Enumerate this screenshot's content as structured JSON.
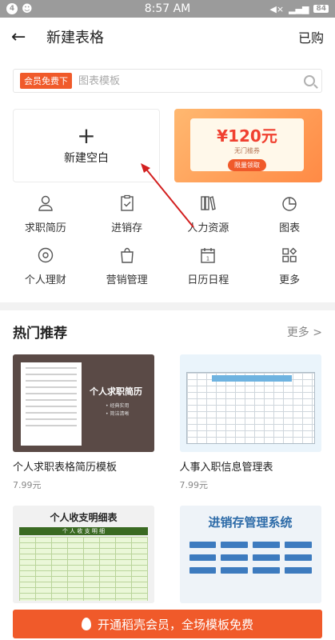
{
  "status": {
    "badge": "4",
    "time": "8:57 AM",
    "battery": "84"
  },
  "header": {
    "title": "新建表格",
    "action": "已购"
  },
  "search": {
    "vip_tag": "会员免费下",
    "placeholder": "图表模板"
  },
  "blank": {
    "label": "新建空白"
  },
  "promo": {
    "amount": "¥120元",
    "subtitle": "无门槛券",
    "button": "限量领取"
  },
  "categories": [
    {
      "label": "求职简历",
      "icon": "user-icon"
    },
    {
      "label": "进销存",
      "icon": "clipboard-icon"
    },
    {
      "label": "人力资源",
      "icon": "books-icon"
    },
    {
      "label": "图表",
      "icon": "pie-chart-icon"
    },
    {
      "label": "个人理财",
      "icon": "coin-icon"
    },
    {
      "label": "营销管理",
      "icon": "shopping-bag-icon"
    },
    {
      "label": "日历日程",
      "icon": "calendar-icon"
    },
    {
      "label": "更多",
      "icon": "grid-more-icon"
    }
  ],
  "hot": {
    "title": "热门推荐",
    "more": "更多 >",
    "templates": [
      {
        "name": "个人求职表格简历模板",
        "price": "7.99元",
        "thumb_title": "个人求职简历",
        "thumb_bullets": [
          "• 经典实用",
          "• 简洁清晰"
        ]
      },
      {
        "name": "人事入职信息管理表",
        "price": "7.99元"
      },
      {
        "name": "",
        "price": "",
        "thumb_title": "个人收支明细表",
        "thumb_bar": "个 人 收 支 明 细"
      },
      {
        "name": "",
        "price": "",
        "thumb_title": "进销存管理系统"
      }
    ]
  },
  "vip_banner": {
    "label": "开通稻壳会员，全场模板免费"
  }
}
